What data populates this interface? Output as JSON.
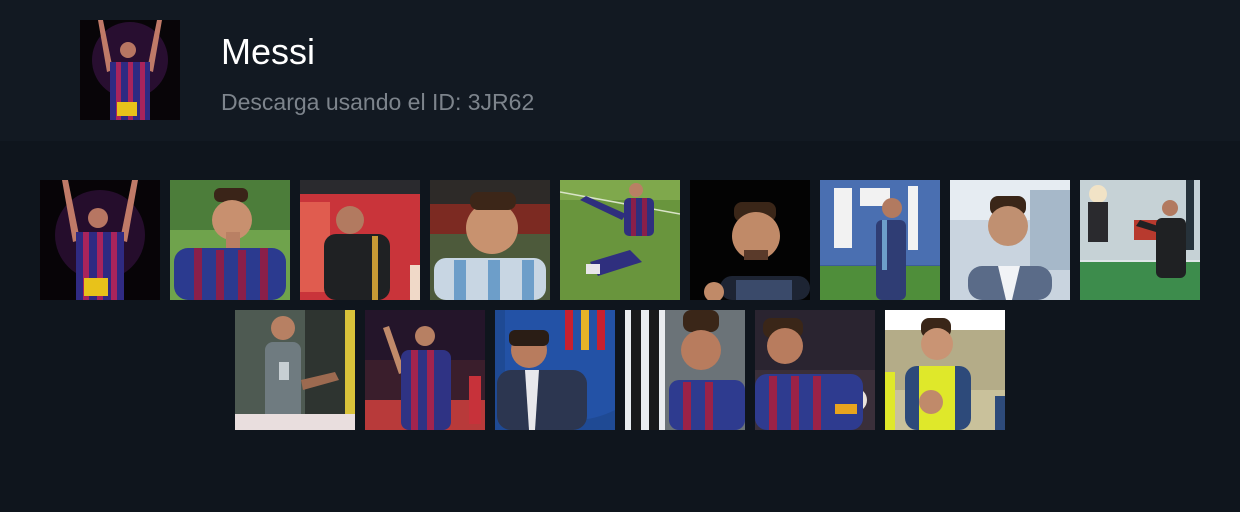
{
  "sticker_pack": {
    "title": "Messi",
    "subtitle": "Descarga usando el ID: 3JR62",
    "avatar_icon": "sticker-pack-cover-icon"
  },
  "stickers": [
    {
      "id": "1",
      "icon": "messi-arms-raised-purple-glow"
    },
    {
      "id": "2",
      "icon": "messi-barcelona-stripes-looking-left"
    },
    {
      "id": "3",
      "icon": "messi-black-kit-head-down"
    },
    {
      "id": "4",
      "icon": "messi-argentina-smiling-close-up"
    },
    {
      "id": "5",
      "icon": "messi-sitting-on-pitch"
    },
    {
      "id": "6",
      "icon": "messi-smiling-portrait-black-background"
    },
    {
      "id": "7",
      "icon": "messi-argentina-blue-kit-stadium"
    },
    {
      "id": "8",
      "icon": "messi-white-shirt-close-up"
    },
    {
      "id": "9",
      "icon": "messi-black-kit-celebrating"
    },
    {
      "id": "10",
      "icon": "messi-argentina-grey-kit-gesture"
    },
    {
      "id": "11",
      "icon": "messi-barcelona-pointing-up"
    },
    {
      "id": "12",
      "icon": "messi-suit-laughing-fcb-crest"
    },
    {
      "id": "13",
      "icon": "messi-barcelona-close-up-crowd"
    },
    {
      "id": "14",
      "icon": "messi-barcelona-captain-armband"
    },
    {
      "id": "15",
      "icon": "young-messi-yellow-vest"
    }
  ]
}
